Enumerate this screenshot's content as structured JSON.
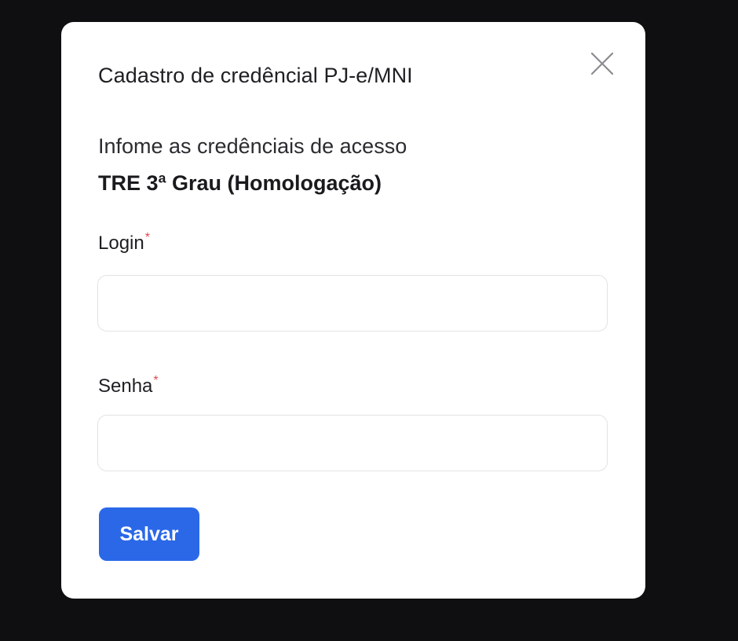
{
  "modal": {
    "title": "Cadastro de credêncial PJ-e/MNI",
    "close_icon": "close-icon",
    "instruction": "Infome as credênciais de acesso",
    "court_name": "TRE 3ª Grau (Homologação)"
  },
  "form": {
    "login": {
      "label": "Login",
      "required_mark": "*",
      "value": "",
      "placeholder": ""
    },
    "senha": {
      "label": "Senha",
      "required_mark": "*",
      "value": "",
      "placeholder": ""
    },
    "save_label": "Salvar"
  },
  "colors": {
    "backdrop": "#0f0f11",
    "modal_background": "#ffffff",
    "primary_button": "#2a68e8",
    "required_mark": "#e5484d"
  }
}
